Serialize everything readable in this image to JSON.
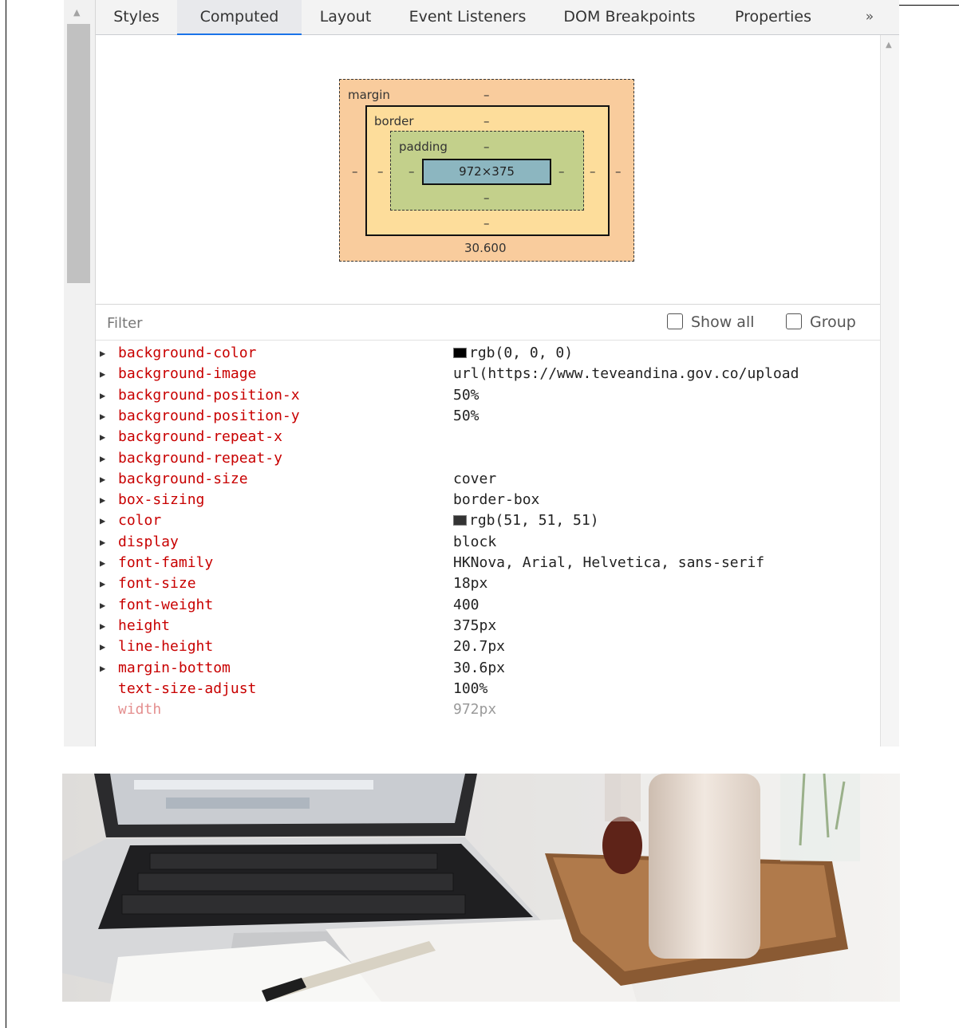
{
  "tabs": [
    {
      "label": "Styles",
      "active": false
    },
    {
      "label": "Computed",
      "active": true
    },
    {
      "label": "Layout",
      "active": false
    },
    {
      "label": "Event Listeners",
      "active": false
    },
    {
      "label": "DOM Breakpoints",
      "active": false
    },
    {
      "label": "Properties",
      "active": false
    }
  ],
  "more_tabs_glyph": "»",
  "box_model": {
    "margin_label": "margin",
    "border_label": "border",
    "padding_label": "padding",
    "content_size": "972×375",
    "margin_bottom": "30.600",
    "dash": "–"
  },
  "filter": {
    "placeholder": "Filter",
    "show_all_label": "Show all",
    "group_label": "Group"
  },
  "properties": [
    {
      "name": "background-color",
      "value": "rgb(0, 0, 0)",
      "swatch": "#000000",
      "expandable": true
    },
    {
      "name": "background-image",
      "value": "url(https://www.teveandina.gov.co/upload",
      "expandable": true
    },
    {
      "name": "background-position-x",
      "value": "50%",
      "expandable": true
    },
    {
      "name": "background-position-y",
      "value": "50%",
      "expandable": true
    },
    {
      "name": "background-repeat-x",
      "value": "",
      "expandable": true
    },
    {
      "name": "background-repeat-y",
      "value": "",
      "expandable": true
    },
    {
      "name": "background-size",
      "value": "cover",
      "expandable": true
    },
    {
      "name": "box-sizing",
      "value": "border-box",
      "expandable": true
    },
    {
      "name": "color",
      "value": "rgb(51, 51, 51)",
      "swatch": "#333333",
      "expandable": true
    },
    {
      "name": "display",
      "value": "block",
      "expandable": true
    },
    {
      "name": "font-family",
      "value": "HKNova, Arial, Helvetica, sans-serif",
      "expandable": true
    },
    {
      "name": "font-size",
      "value": "18px",
      "expandable": true
    },
    {
      "name": "font-weight",
      "value": "400",
      "expandable": true
    },
    {
      "name": "height",
      "value": "375px",
      "expandable": true
    },
    {
      "name": "line-height",
      "value": "20.7px",
      "expandable": true
    },
    {
      "name": "margin-bottom",
      "value": "30.6px",
      "expandable": true
    },
    {
      "name": "text-size-adjust",
      "value": "100%",
      "expandable": false
    },
    {
      "name": "width",
      "value": "972px",
      "expandable": false,
      "inherited": true
    }
  ],
  "colors": {
    "property_name": "#c80000",
    "active_tab_underline": "#1a73e8",
    "margin_box": "#f9cc9d",
    "border_box": "#fddd9b",
    "padding_box": "#c3d08b",
    "content_box": "#8cb6c0"
  }
}
